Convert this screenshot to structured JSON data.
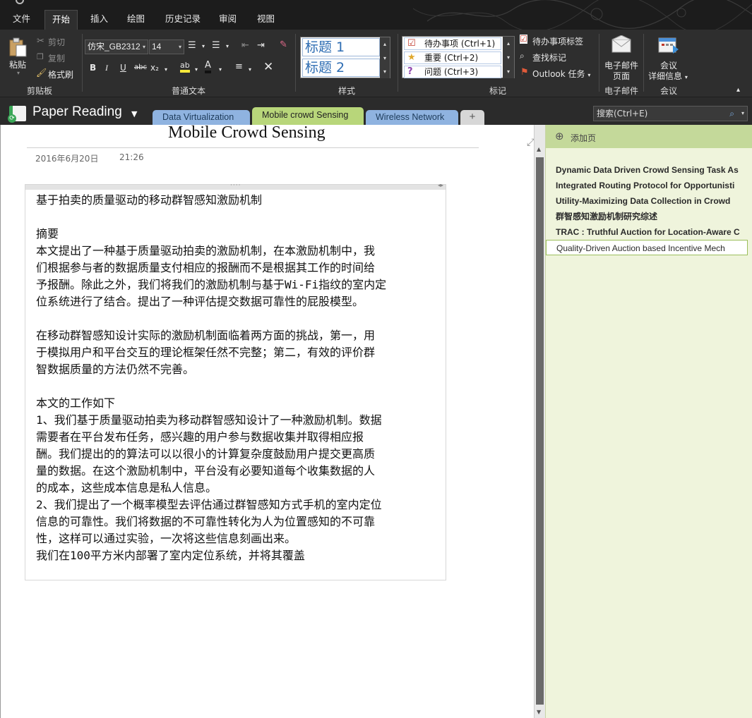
{
  "menu": {
    "tabs": [
      "文件",
      "开始",
      "插入",
      "绘图",
      "历史记录",
      "审阅",
      "视图"
    ],
    "active": "开始"
  },
  "ribbon": {
    "clipboard": {
      "paste": "粘贴",
      "cut": "剪切",
      "copy": "复制",
      "format_painter": "格式刷",
      "label": "剪贴板"
    },
    "basic_text": {
      "font": "仿宋_GB2312",
      "size": "14",
      "label": "普通文本",
      "bold": "B",
      "italic": "I",
      "underline": "U",
      "strike": "abc",
      "subscript": "x₂",
      "highlight": "ab",
      "font_color": "A"
    },
    "styles": {
      "heading1": "标题 1",
      "heading2": "标题 2",
      "label": "样式"
    },
    "tags": {
      "todo": "待办事项 (Ctrl+1)",
      "important": "重要 (Ctrl+2)",
      "question": "问题 (Ctrl+3)",
      "todo_tag": "待办事项标签",
      "find_tags": "查找标记",
      "outlook_tasks": "Outlook 任务",
      "label": "标记"
    },
    "email": {
      "button": "电子邮件",
      "button2": "页面",
      "label": "电子邮件"
    },
    "meeting": {
      "button": "会议",
      "button2": "详细信息",
      "label": "会议"
    }
  },
  "notebook": {
    "name": "Paper Reading",
    "sections": [
      {
        "label": "Data Virtualization",
        "color": "#8fb3e0"
      },
      {
        "label": "Mobile crowd Sensing",
        "color": "#b8d67a"
      },
      {
        "label": "Wireless Network",
        "color": "#8fb3e0"
      }
    ],
    "add_section": "+",
    "search_placeholder": "搜索(Ctrl+E)"
  },
  "page": {
    "title": "Mobile Crowd Sensing",
    "date": "2016年6月20日",
    "time": "21:26",
    "lines": [
      "基于拍卖的质量驱动的移动群智感知激励机制",
      "",
      "摘要",
      "本文提出了一种基于质量驱动拍卖的激励机制，在本激励机制中，我",
      "们根据参与者的数据质量支付相应的报酬而不是根据其工作的时间给",
      "予报酬。除此之外，我们将我们的激励机制与基于Wi-Fi指纹的室内定",
      "位系统进行了结合。提出了一种评估提交数据可靠性的屁股模型。",
      "",
      "在移动群智感知设计实际的激励机制面临着两方面的挑战，第一，用",
      "于模拟用户和平台交互的理论框架任然不完整；第二，有效的评价群",
      "智数据质量的方法仍然不完善。",
      "",
      "本文的工作如下",
      "1、我们基于质量驱动拍卖为移动群智感知设计了一种激励机制。数据",
      "需要者在平台发布任务，感兴趣的用户参与数据收集并取得相应报",
      "酬。我们提出的的算法可以以很小的计算复杂度鼓励用户提交更高质",
      "量的数据。在这个激励机制中，平台没有必要知道每个收集数据的人",
      "的成本，这些成本信息是私人信息。",
      "2、我们提出了一个概率模型去评估通过群智感知方式手机的室内定位",
      "信息的可靠性。我们将数据的不可靠性转化为人为位置感知的不可靠",
      "性，这样可以通过实验，一次将这些信息刻画出来。",
      "我们在100平方米内部署了室内定位系统，并将其覆盖"
    ]
  },
  "pagelist": {
    "add_page": "添加页",
    "items": [
      {
        "label": "Dynamic Data Driven Crowd Sensing Task As",
        "bold": true
      },
      {
        "label": "Integrated Routing Protocol for Opportunisti",
        "bold": true
      },
      {
        "label": "Utility-Maximizing Data Collection in Crowd",
        "bold": true
      },
      {
        "label": "群智感知激励机制研究综述",
        "bold": true
      },
      {
        "label": "TRAC : Truthful Auction for Location-Aware C",
        "bold": true
      },
      {
        "label": "Quality-Driven Auction based Incentive Mech",
        "bold": false,
        "selected": true
      }
    ]
  }
}
